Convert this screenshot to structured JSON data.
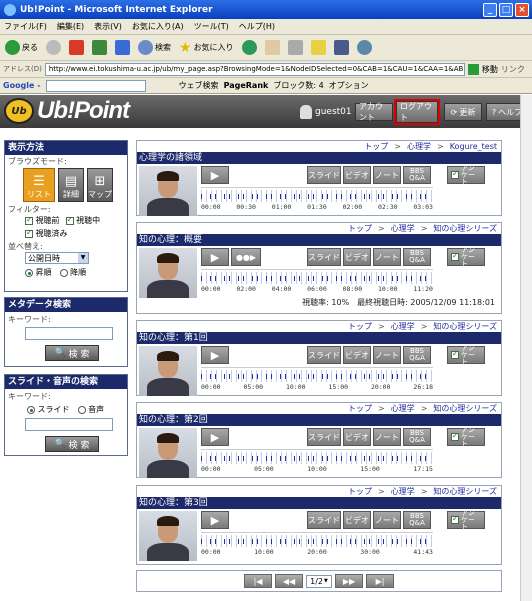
{
  "window": {
    "title": "Ub!Point - Microsoft Internet Explorer"
  },
  "menu": [
    "ファイル(F)",
    "編集(E)",
    "表示(V)",
    "お気に入り(A)",
    "ツール(T)",
    "ヘルプ(H)"
  ],
  "toolbar": {
    "back": "戻る",
    "search": "検索",
    "favorites": "お気に入り"
  },
  "address": {
    "label": "アドレス(D)",
    "url": "http://www.ei.tokushima-u.ac.jp/ub/my_page.asp?BrowsingMode=1&NodeIDSelected=0&CAB=1&CAU=1&CAA=1&AB=1&AL",
    "go": "移動",
    "links": "リンク"
  },
  "googlebar": {
    "brand": "Google -",
    "web_search": "ウェブ検索",
    "pagerank": "PageRank",
    "blocked": "ブロック数: 4",
    "options": "オプション"
  },
  "site": {
    "logo_badge": "Ub",
    "logo_text": "Ub!Point",
    "user": "guest01",
    "account": "アカウント",
    "logout": "ログアウト",
    "refresh": "更新",
    "help": "ヘルプ"
  },
  "display": {
    "heading": "表示方法",
    "browse_mode_label": "ブラウズモード:",
    "mode_list": "リスト",
    "mode_detail": "詳細",
    "mode_map": "マップ",
    "filter_label": "フィルター:",
    "filter_before": "視聴前",
    "filter_during": "視聴中",
    "filter_done": "視聴済み",
    "sort_label": "並べ替え:",
    "sort_value": "公開日時",
    "asc": "昇順",
    "desc": "降順"
  },
  "meta_search": {
    "heading": "メタデータ検索",
    "keyword_label": "キーワード:",
    "button": "検 索"
  },
  "slide_search": {
    "heading": "スライド・音声の検索",
    "keyword_label": "キーワード:",
    "opt_slide": "スライド",
    "opt_audio": "音声",
    "button": "検 索"
  },
  "lectures": [
    {
      "crumbs": [
        "トップ",
        "心理学",
        "Kogure_test"
      ],
      "title": "心理学の諸領域",
      "buttons": {
        "slide": "スライド",
        "video": "ビデオ",
        "note": "ノート",
        "bbs": "BBS Q&A",
        "survey": "アン ケート"
      },
      "ticks": [
        "00:00",
        "00:30",
        "01:00",
        "01:30",
        "02:00",
        "02:30",
        "03:03"
      ],
      "status": ""
    },
    {
      "crumbs": [
        "トップ",
        "心理学",
        "知の心理シリーズ"
      ],
      "title": "知の心理：概要",
      "buttons": {
        "slide": "スライド",
        "video": "ビデオ",
        "note": "ノート",
        "bbs": "BBS Q&A",
        "survey": "アン ケート"
      },
      "ticks": [
        "00:00",
        "02:00",
        "04:00",
        "06:00",
        "08:00",
        "10:00",
        "11:20"
      ],
      "status": "視聴率: 10%　最終視聴日時: 2005/12/09 11:18:01"
    },
    {
      "crumbs": [
        "トップ",
        "心理学",
        "知の心理シリーズ"
      ],
      "title": "知の心理：第1回",
      "buttons": {
        "slide": "スライド",
        "video": "ビデオ",
        "note": "ノート",
        "bbs": "BBS Q&A",
        "survey": "アン ケート"
      },
      "ticks": [
        "00:00",
        "05:00",
        "10:00",
        "15:00",
        "20:00",
        "26:18"
      ],
      "status": ""
    },
    {
      "crumbs": [
        "トップ",
        "心理学",
        "知の心理シリーズ"
      ],
      "title": "知の心理：第2回",
      "buttons": {
        "slide": "スライド",
        "video": "ビデオ",
        "note": "ノート",
        "bbs": "BBS Q&A",
        "survey": "アン ケート"
      },
      "ticks": [
        "00:00",
        "05:00",
        "10:00",
        "15:00",
        "17:15"
      ],
      "status": ""
    },
    {
      "crumbs": [
        "トップ",
        "心理学",
        "知の心理シリーズ"
      ],
      "title": "知の心理：第3回",
      "buttons": {
        "slide": "スライド",
        "video": "ビデオ",
        "note": "ノート",
        "bbs": "BBS Q&A",
        "survey": "アン ケート"
      },
      "ticks": [
        "00:00",
        "10:00",
        "20:00",
        "30:00",
        "41:43"
      ],
      "status": ""
    }
  ],
  "pager": {
    "first": "|◀",
    "prev": "◀◀",
    "page": "1/2",
    "next": "▶▶",
    "last": "▶|"
  },
  "colors": {
    "navy": "#1c2a6b",
    "logout_border": "#e00000"
  }
}
